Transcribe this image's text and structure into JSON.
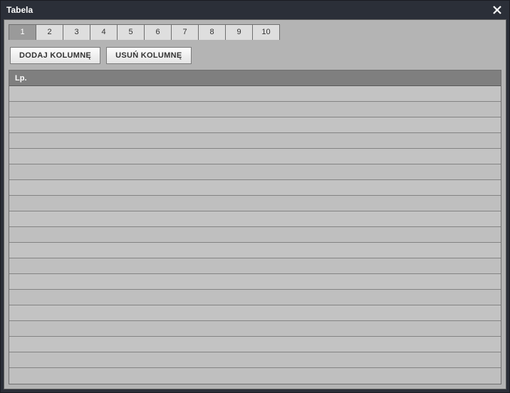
{
  "window": {
    "title": "Tabela"
  },
  "tabs": {
    "items": [
      {
        "label": "1",
        "active": true
      },
      {
        "label": "2",
        "active": false
      },
      {
        "label": "3",
        "active": false
      },
      {
        "label": "4",
        "active": false
      },
      {
        "label": "5",
        "active": false
      },
      {
        "label": "6",
        "active": false
      },
      {
        "label": "7",
        "active": false
      },
      {
        "label": "8",
        "active": false
      },
      {
        "label": "9",
        "active": false
      },
      {
        "label": "10",
        "active": false
      }
    ]
  },
  "toolbar": {
    "add_column_label": "DODAJ KOLUMNĘ",
    "remove_column_label": "USUŃ KOLUMNĘ"
  },
  "grid": {
    "columns": [
      {
        "label": "Lp."
      }
    ],
    "row_count": 18
  }
}
